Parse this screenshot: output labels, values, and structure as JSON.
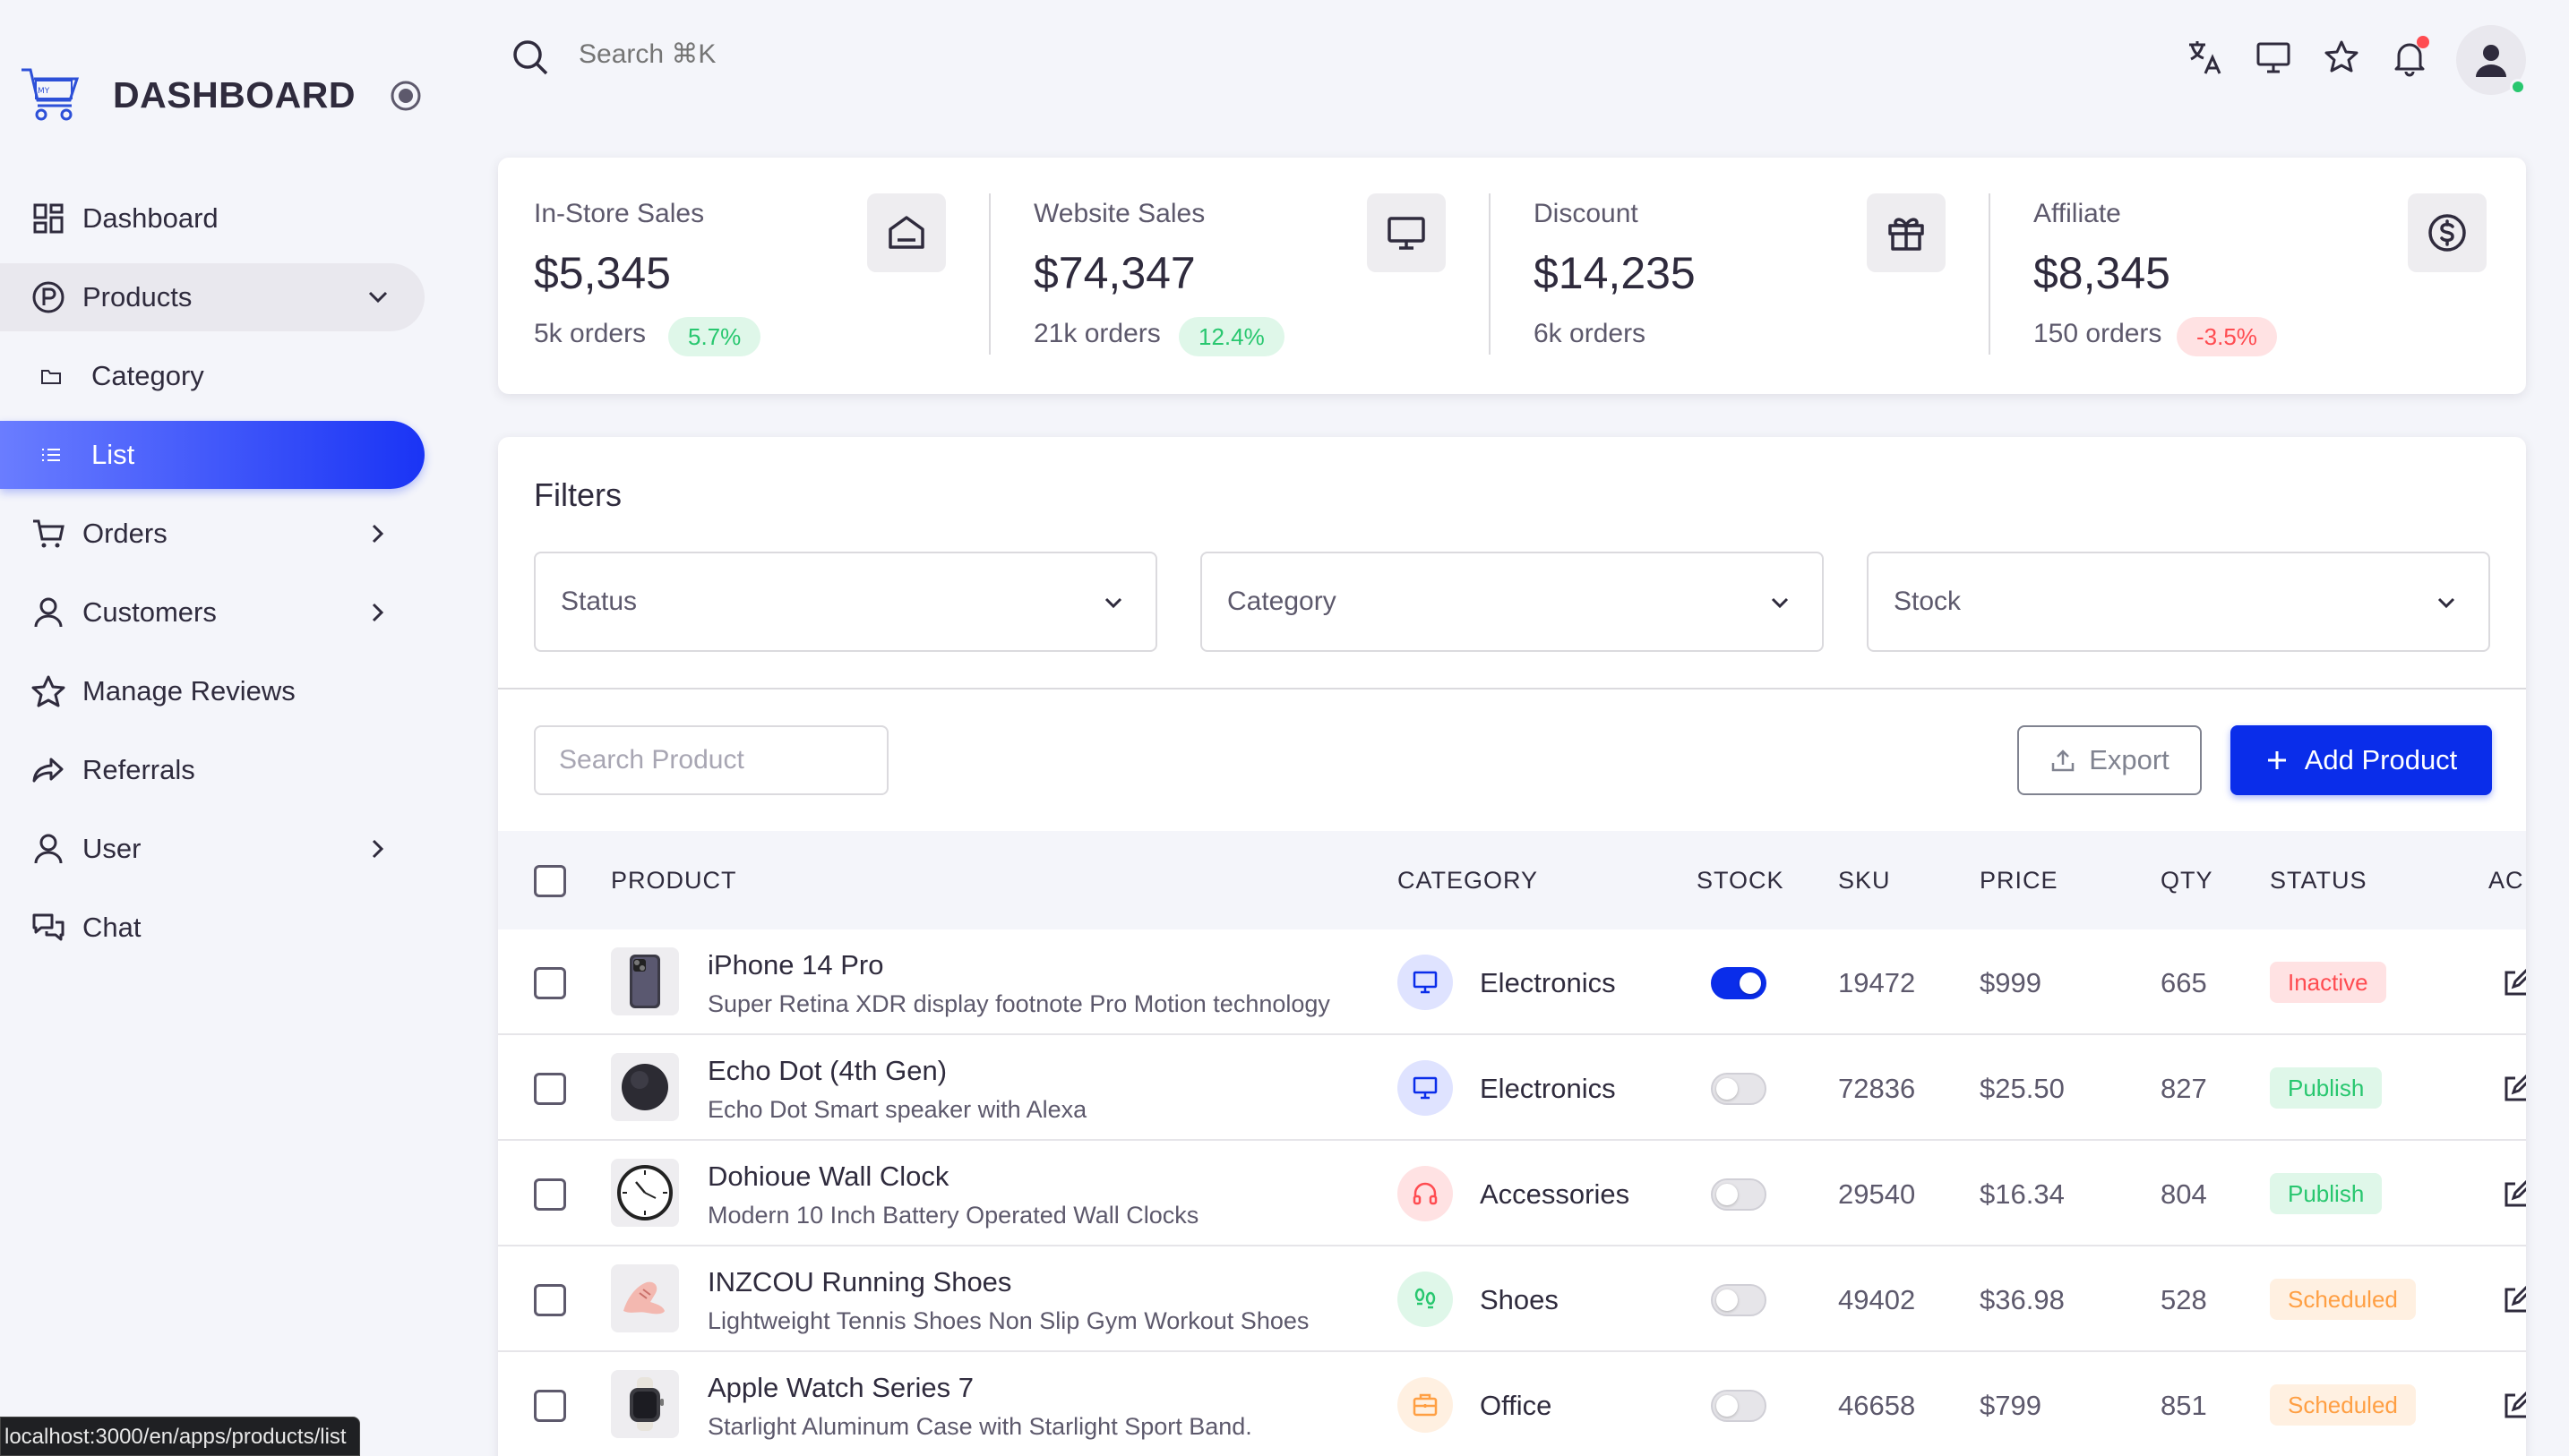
{
  "brand": {
    "title": "DASHBOARD"
  },
  "sidebar": {
    "items": [
      {
        "label": "Dashboard"
      },
      {
        "label": "Products"
      },
      {
        "label": "Category"
      },
      {
        "label": "List"
      },
      {
        "label": "Orders"
      },
      {
        "label": "Customers"
      },
      {
        "label": "Manage Reviews"
      },
      {
        "label": "Referrals"
      },
      {
        "label": "User"
      },
      {
        "label": "Chat"
      }
    ]
  },
  "topbar": {
    "search_placeholder": "Search ⌘K"
  },
  "stats": [
    {
      "label": "In-Store Sales",
      "value": "$5,345",
      "orders": "5k orders",
      "badge": "5.7%",
      "icon": "store-icon"
    },
    {
      "label": "Website Sales",
      "value": "$74,347",
      "orders": "21k orders",
      "badge": "12.4%",
      "icon": "monitor-icon"
    },
    {
      "label": "Discount",
      "value": "$14,235",
      "orders": "6k orders",
      "badge": "",
      "icon": "gift-icon"
    },
    {
      "label": "Affiliate",
      "value": "$8,345",
      "orders": "150 orders",
      "badge": "-3.5%",
      "icon": "dollar-icon"
    }
  ],
  "filters": {
    "title": "Filters",
    "status_label": "Status",
    "category_label": "Category",
    "stock_label": "Stock"
  },
  "toolbar": {
    "search_placeholder": "Search Product",
    "export_label": "Export",
    "add_label": "Add Product"
  },
  "table": {
    "headers": {
      "product": "PRODUCT",
      "category": "CATEGORY",
      "stock": "STOCK",
      "sku": "SKU",
      "price": "PRICE",
      "qty": "QTY",
      "status": "STATUS",
      "actions": "AC"
    },
    "rows": [
      {
        "name": "iPhone 14 Pro",
        "desc": "Super Retina XDR display footnote Pro Motion technology",
        "category": "Electronics",
        "stock": true,
        "sku": "19472",
        "price": "$999",
        "qty": "665",
        "status": "Inactive"
      },
      {
        "name": "Echo Dot (4th Gen)",
        "desc": "Echo Dot Smart speaker with Alexa",
        "category": "Electronics",
        "stock": false,
        "sku": "72836",
        "price": "$25.50",
        "qty": "827",
        "status": "Publish"
      },
      {
        "name": "Dohioue Wall Clock",
        "desc": "Modern 10 Inch Battery Operated Wall Clocks",
        "category": "Accessories",
        "stock": false,
        "sku": "29540",
        "price": "$16.34",
        "qty": "804",
        "status": "Publish"
      },
      {
        "name": "INZCOU Running Shoes",
        "desc": "Lightweight Tennis Shoes Non Slip Gym Workout Shoes",
        "category": "Shoes",
        "stock": false,
        "sku": "49402",
        "price": "$36.98",
        "qty": "528",
        "status": "Scheduled"
      },
      {
        "name": "Apple Watch Series 7",
        "desc": "Starlight Aluminum Case with Starlight Sport Band.",
        "category": "Office",
        "stock": false,
        "sku": "46658",
        "price": "$799",
        "qty": "851",
        "status": "Scheduled"
      }
    ]
  },
  "browser_status": {
    "url": "localhost:3000/en/apps/products/list"
  },
  "colors": {
    "primary": "#0a2dea",
    "success": "#28c76f",
    "danger": "#ff4c51",
    "warning": "#ff9f43"
  }
}
